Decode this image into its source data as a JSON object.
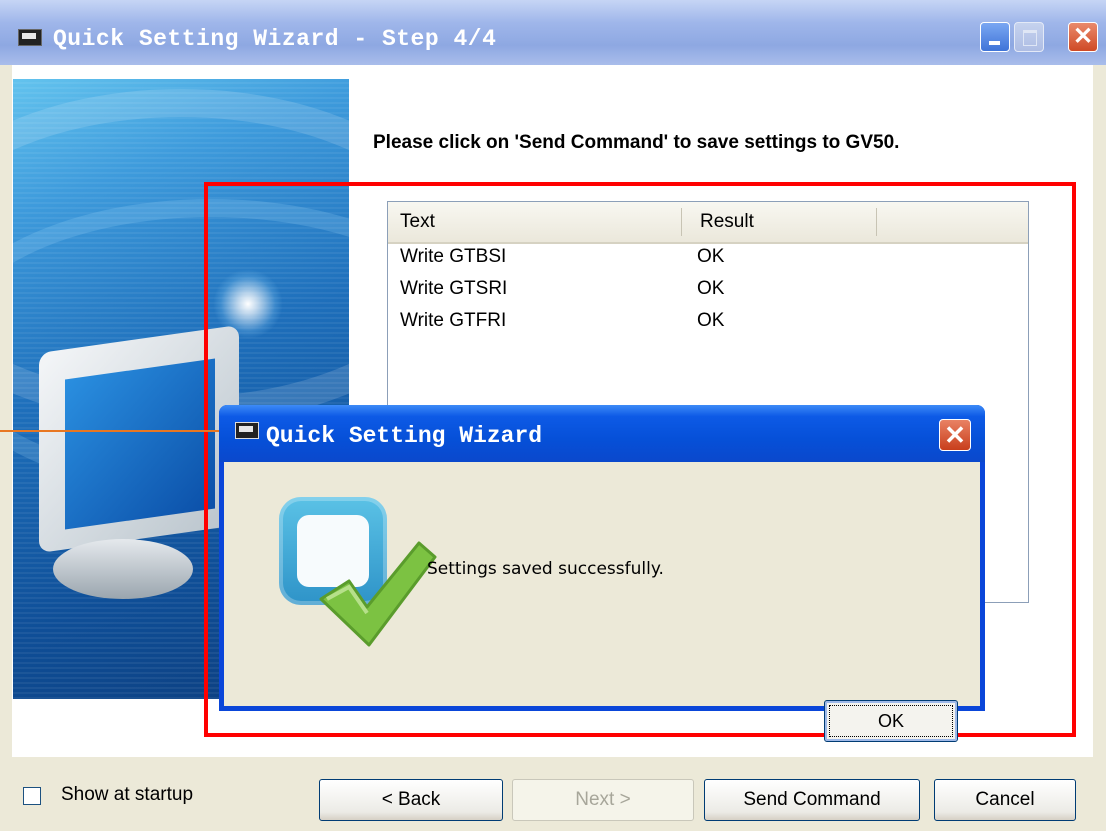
{
  "window": {
    "title": "Quick Setting Wizard - Step 4/4",
    "close_glyph": "✕"
  },
  "instruction": "Please click on 'Send Command' to save settings to GV50.",
  "list": {
    "columns": [
      "Text",
      "Result"
    ],
    "rows": [
      {
        "text": "Write GTBSI",
        "result": "OK"
      },
      {
        "text": "Write GTSRI",
        "result": "OK"
      },
      {
        "text": "Write GTFRI",
        "result": "OK"
      }
    ]
  },
  "dialog": {
    "title": "Quick Setting Wizard",
    "close_glyph": "✕",
    "message": "Settings saved successfully.",
    "ok_label": "OK",
    "icon": "success-check-icon"
  },
  "footer": {
    "show_at_startup": "Show at startup",
    "back_label": "< Back",
    "next_label": "Next >",
    "send_label": "Send Command",
    "cancel_label": "Cancel"
  },
  "colors": {
    "highlight_frame": "#ff0000",
    "callout": "#e87722",
    "dialog_title": "#0650d8",
    "window_title": "#8ea8e2"
  }
}
